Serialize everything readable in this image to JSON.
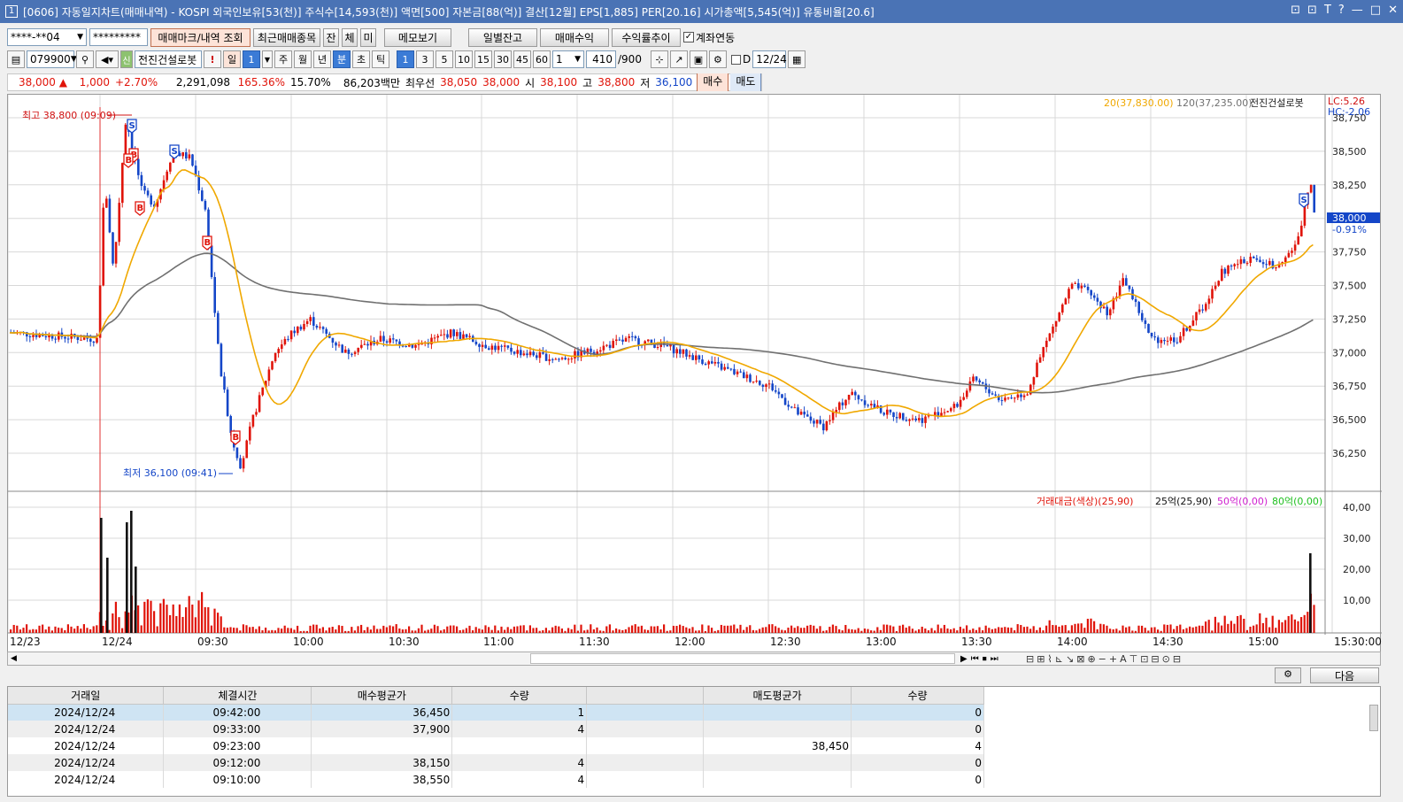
{
  "window": {
    "title": "[0606] 자동일지차트(매매내역) - KOSPI 외국인보유[53(천)] 주식수[14,593(천)] 액면[500] 자본금[88(억)] 결산[12월] EPS[1,885] PER[20.16] 시가총액[5,545(억)] 유통비율[20.6]",
    "icon": "1",
    "controls": [
      "⊡",
      "⊡",
      "T",
      "?",
      "—",
      "□",
      "✕"
    ]
  },
  "toolbar1": {
    "account": "****-**04",
    "password": "*********",
    "btn_trade_mark": "매매마크/내역 조회",
    "btn_recent": "최근매매종목",
    "btn_jan": "잔",
    "btn_che": "체",
    "btn_mi": "미",
    "btn_memo": "메모보기",
    "btn_daily": "일별잔고",
    "btn_profit": "매매수익",
    "btn_yield": "수익률추이",
    "chk_link": "계좌연동"
  },
  "toolbar2": {
    "code": "079900",
    "new_badge": "신",
    "stock_name": "전진건설로봇",
    "excl": "!",
    "period_day": "일",
    "period_day_num": "1",
    "period_week": "주",
    "period_month": "월",
    "period_year": "년",
    "period_min": "분",
    "period_sec": "초",
    "period_tick": "틱",
    "mins": [
      "1",
      "3",
      "5",
      "10",
      "15",
      "30",
      "45",
      "60"
    ],
    "min_custom": "1",
    "count": "410",
    "count_total": "/900",
    "d_label": "D",
    "date": "12/24"
  },
  "quote": {
    "price": "38,000",
    "arrow": "▲",
    "change": "1,000",
    "pct": "+2.70%",
    "volume": "2,291,098",
    "vol_ratio": "165.36%",
    "turnover": "15.70%",
    "amount": "86,203백만",
    "best_label": "최우선",
    "best_ask": "38,050",
    "best_bid": "38,000",
    "open_label": "시",
    "open": "38,100",
    "high_label": "고",
    "high": "38,800",
    "low_label": "저",
    "low": "36,100",
    "buy": "매수",
    "sell": "매도"
  },
  "chart": {
    "ma_legend": [
      "20(37,830.00)",
      "120(37,235.00)",
      "전진건설로봇"
    ],
    "lc": "LC:5.26",
    "hc": "HC:-2.06",
    "max_label": "최고 38,800 (09:09)",
    "min_label": "최저 36,100 (09:41)",
    "current_price": "38,000",
    "current_pct": "-0.91%",
    "price_ticks": [
      "38,750",
      "38,500",
      "38,250",
      "38,000",
      "37,750",
      "37,500",
      "37,250",
      "37,000",
      "36,750",
      "36,500",
      "36,250"
    ],
    "vol_legend": [
      "거래대금(색상)(25,90)",
      "25억(25,90)",
      "50억(0,00)",
      "80억(0,00)"
    ],
    "vol_ticks": [
      "40,00",
      "30,00",
      "20,00",
      "10,00"
    ],
    "time_labels": [
      "12/23",
      "12/24",
      "09:30",
      "10:00",
      "10:30",
      "11:00",
      "11:30",
      "12:00",
      "12:30",
      "13:00",
      "13:30",
      "14:00",
      "14:30",
      "15:00",
      "15:30:00"
    ]
  },
  "table": {
    "headers": [
      "거래일",
      "체결시간",
      "매수평균가",
      "수량",
      "",
      "매도평균가",
      "수량"
    ],
    "rows": [
      [
        "2024/12/24",
        "09:42:00",
        "36,450",
        "1",
        "",
        "",
        "0"
      ],
      [
        "2024/12/24",
        "09:33:00",
        "37,900",
        "4",
        "",
        "",
        "0"
      ],
      [
        "2024/12/24",
        "09:23:00",
        "",
        "",
        "",
        "38,450",
        "4"
      ],
      [
        "2024/12/24",
        "09:12:00",
        "38,150",
        "4",
        "",
        "",
        "0"
      ],
      [
        "2024/12/24",
        "09:10:00",
        "38,550",
        "4",
        "",
        "",
        "0"
      ]
    ],
    "next_btn": "다음"
  },
  "colors": {
    "up": "#e0140a",
    "down": "#1446c8",
    "ma20": "#f0a800",
    "ma120": "#707070",
    "title_bg": "#4a73b5"
  }
}
